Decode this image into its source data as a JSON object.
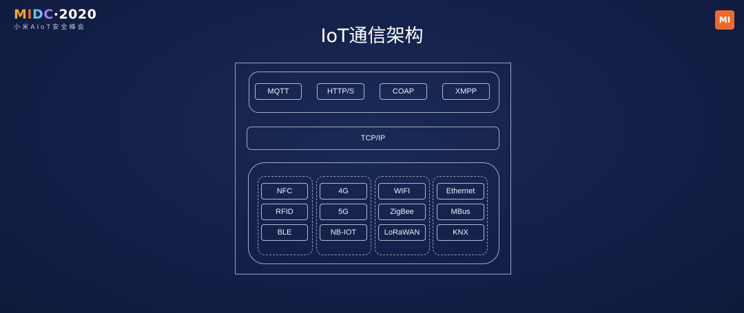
{
  "brand": {
    "logo_m": "M",
    "logo_i": "I",
    "logo_d": "D",
    "logo_c": "C",
    "logo_year": "·2020",
    "subtitle": "小米AIoT安全峰会",
    "badge": "MI",
    "colors": {
      "m": "#f4a72b",
      "i": "#f0672a",
      "d": "#5ec6e8",
      "c": "#a97de8",
      "badge": "#ee6a2c"
    }
  },
  "title": "IoT通信架构",
  "diagram": {
    "application_protocols": [
      "MQTT",
      "HTTP/S",
      "COAP",
      "XMPP"
    ],
    "transport": "TCP/IP",
    "link_columns": [
      [
        "NFC",
        "RFID",
        "BLE"
      ],
      [
        "4G",
        "5G",
        "NB-IOT"
      ],
      [
        "WIFI",
        "ZigBee",
        "LoRaWAN"
      ],
      [
        "Ethernet",
        "MBus",
        "KNX"
      ]
    ]
  },
  "colors": {
    "background": "#14214a",
    "line": "#d2dcf0"
  }
}
